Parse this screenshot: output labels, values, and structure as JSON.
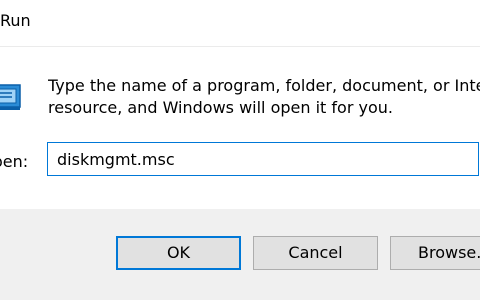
{
  "window": {
    "title": "Run"
  },
  "dialog": {
    "description_line1": "Type the name of a program, folder, document, or Intern",
    "description_line2": "resource, and Windows will open it for you.",
    "open_label": "Open:",
    "command_value": "diskmgmt.msc",
    "icon": "run-app-icon"
  },
  "buttons": {
    "ok_label": "OK",
    "cancel_label": "Cancel",
    "browse_label": "Browse..."
  },
  "colors": {
    "accent": "#0078d7",
    "button_bar": "#f0f0f0",
    "button_face": "#e1e1e1"
  }
}
